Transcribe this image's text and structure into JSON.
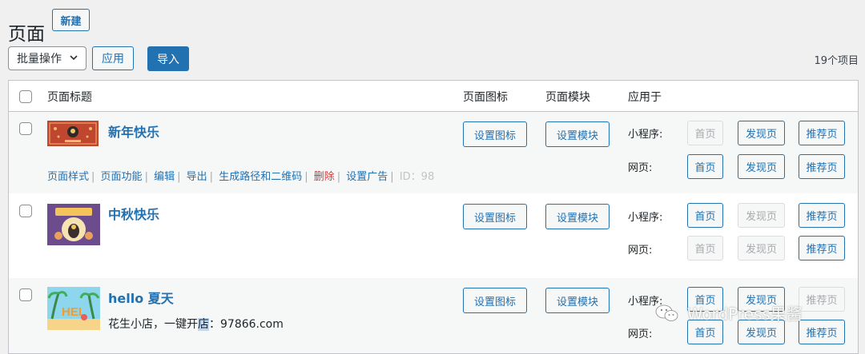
{
  "header": {
    "title": "页面",
    "new_label": "新建"
  },
  "toolbar": {
    "bulk_action": "批量操作",
    "apply_label": "应用",
    "import_label": "导入",
    "items_count": "19个项目"
  },
  "table": {
    "columns": [
      "页面标题",
      "页面图标",
      "页面模块",
      "应用于"
    ],
    "set_icon_label": "设置图标",
    "set_module_label": "设置模块",
    "mini_label": "小程序:",
    "web_label": "网页:",
    "page_labels": [
      "首页",
      "发现页",
      "推荐页"
    ],
    "rows": [
      {
        "title": "新年快乐",
        "actions": [
          "页面样式",
          "页面功能",
          "编辑",
          "导出",
          "生成路径和二维码",
          "删除",
          "设置广告"
        ],
        "id_text": "ID：98",
        "mini_enabled": [
          false,
          true,
          true
        ],
        "web_enabled": [
          true,
          true,
          true
        ]
      },
      {
        "title": "中秋快乐",
        "mini_enabled": [
          true,
          false,
          true
        ],
        "web_enabled": [
          false,
          false,
          true
        ]
      },
      {
        "title": "hello 夏天",
        "subtitle_pre": "花生小店，一键开",
        "subtitle_hl": "店",
        "subtitle_post": "：97866.com",
        "mini_enabled": [
          true,
          true,
          false
        ],
        "web_enabled": [
          true,
          true,
          true
        ]
      }
    ]
  },
  "watermark": {
    "icon": "wechat-icon",
    "text": "WordPress果酱"
  },
  "colors": {
    "accent": "#2271b1",
    "delete": "#d63638"
  }
}
